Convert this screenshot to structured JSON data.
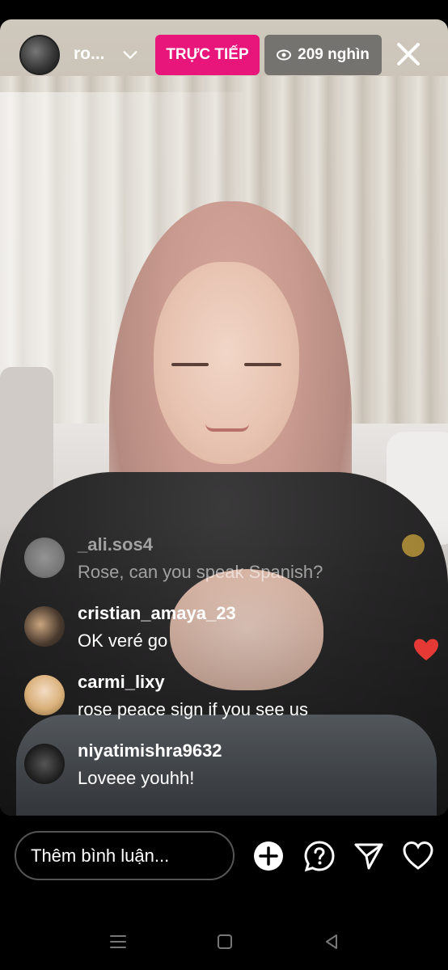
{
  "header": {
    "username": "ro...",
    "live_label": "TRỰC TIẾP",
    "viewer_count": "209 nghìn"
  },
  "comments": [
    {
      "user": "_ali.sos4",
      "text": "Rose, can you speak Spanish?",
      "faded": true
    },
    {
      "user": "cristian_amaya_23",
      "text": "OK veré go"
    },
    {
      "user": "carmi_lixy",
      "text": "rose peace sign if you see us"
    },
    {
      "user": "niyatimishra9632",
      "text": "Loveee youhh!"
    }
  ],
  "composer": {
    "placeholder": "Thêm bình luận..."
  },
  "icons": [
    "chevron-down-icon",
    "eye-icon",
    "close-icon",
    "plus-circle-icon",
    "question-icon",
    "send-icon",
    "heart-icon",
    "recent-apps-icon",
    "home-icon",
    "back-icon"
  ],
  "colors": {
    "live": "#e8157a",
    "heart": "#e53935"
  }
}
